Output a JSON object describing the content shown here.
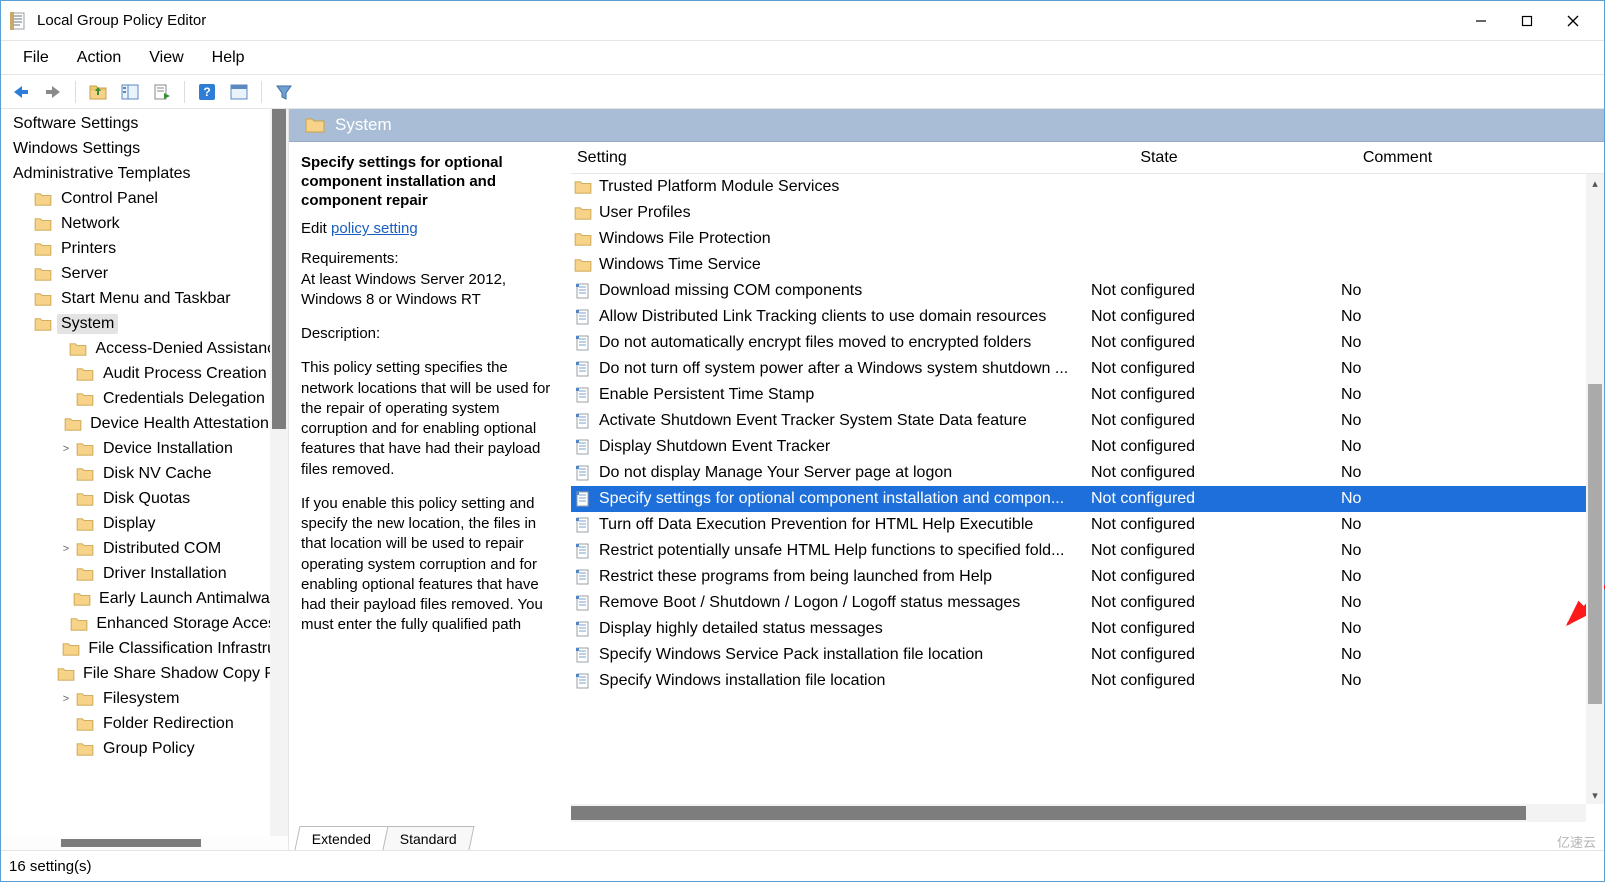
{
  "window": {
    "title": "Local Group Policy Editor"
  },
  "menubar": [
    "File",
    "Action",
    "View",
    "Help"
  ],
  "scope": {
    "label": "System"
  },
  "tree": [
    {
      "label": "Software Settings",
      "indent": 0,
      "icon": "none"
    },
    {
      "label": "Windows Settings",
      "indent": 0,
      "icon": "none"
    },
    {
      "label": "Administrative Templates",
      "indent": 0,
      "icon": "none"
    },
    {
      "label": "Control Panel",
      "indent": 1,
      "icon": "folder"
    },
    {
      "label": "Network",
      "indent": 1,
      "icon": "folder"
    },
    {
      "label": "Printers",
      "indent": 1,
      "icon": "folder"
    },
    {
      "label": "Server",
      "indent": 1,
      "icon": "folder"
    },
    {
      "label": "Start Menu and Taskbar",
      "indent": 1,
      "icon": "folder"
    },
    {
      "label": "System",
      "indent": 1,
      "icon": "folder",
      "selected": true
    },
    {
      "label": "Access-Denied Assistance",
      "indent": 2,
      "icon": "folder"
    },
    {
      "label": "Audit Process Creation",
      "indent": 2,
      "icon": "folder"
    },
    {
      "label": "Credentials Delegation",
      "indent": 2,
      "icon": "folder"
    },
    {
      "label": "Device Health Attestation S",
      "indent": 2,
      "icon": "folder"
    },
    {
      "label": "Device Installation",
      "indent": 2,
      "icon": "folder",
      "expander": ">"
    },
    {
      "label": "Disk NV Cache",
      "indent": 2,
      "icon": "folder"
    },
    {
      "label": "Disk Quotas",
      "indent": 2,
      "icon": "folder"
    },
    {
      "label": "Display",
      "indent": 2,
      "icon": "folder"
    },
    {
      "label": "Distributed COM",
      "indent": 2,
      "icon": "folder",
      "expander": ">"
    },
    {
      "label": "Driver Installation",
      "indent": 2,
      "icon": "folder"
    },
    {
      "label": "Early Launch Antimalware",
      "indent": 2,
      "icon": "folder"
    },
    {
      "label": "Enhanced Storage Access",
      "indent": 2,
      "icon": "folder"
    },
    {
      "label": "File Classification Infrastruc",
      "indent": 2,
      "icon": "folder"
    },
    {
      "label": "File Share Shadow Copy Pro",
      "indent": 2,
      "icon": "folder"
    },
    {
      "label": "Filesystem",
      "indent": 2,
      "icon": "folder",
      "expander": ">"
    },
    {
      "label": "Folder Redirection",
      "indent": 2,
      "icon": "folder"
    },
    {
      "label": "Group Policy",
      "indent": 2,
      "icon": "folder"
    }
  ],
  "description": {
    "title": "Specify settings for optional component installation and component repair",
    "edit_prefix": "Edit",
    "edit_link": "policy setting",
    "requirements_label": "Requirements:",
    "requirements_text": "At least Windows Server 2012, Windows 8 or Windows RT",
    "description_label": "Description:",
    "para1": "This policy setting specifies the network locations that will be used for the repair of operating system corruption and for enabling optional features that have had their payload files removed.",
    "para2": "If you enable this policy setting and specify the new location, the files in that location will be used to repair operating system corruption and for enabling optional features that have had their payload files removed. You must enter the fully qualified path"
  },
  "columns": {
    "setting": "Setting",
    "state": "State",
    "comment": "Comment"
  },
  "settings": [
    {
      "name": "Trusted Platform Module Services",
      "state": "",
      "comment": "",
      "type": "folder"
    },
    {
      "name": "User Profiles",
      "state": "",
      "comment": "",
      "type": "folder"
    },
    {
      "name": "Windows File Protection",
      "state": "",
      "comment": "",
      "type": "folder"
    },
    {
      "name": "Windows Time Service",
      "state": "",
      "comment": "",
      "type": "folder"
    },
    {
      "name": "Download missing COM components",
      "state": "Not configured",
      "comment": "No",
      "type": "policy"
    },
    {
      "name": "Allow Distributed Link Tracking clients to use domain resources",
      "state": "Not configured",
      "comment": "No",
      "type": "policy"
    },
    {
      "name": "Do not automatically encrypt files moved to encrypted folders",
      "state": "Not configured",
      "comment": "No",
      "type": "policy"
    },
    {
      "name": "Do not turn off system power after a Windows system shutdown ...",
      "state": "Not configured",
      "comment": "No",
      "type": "policy"
    },
    {
      "name": "Enable Persistent Time Stamp",
      "state": "Not configured",
      "comment": "No",
      "type": "policy"
    },
    {
      "name": "Activate Shutdown Event Tracker System State Data feature",
      "state": "Not configured",
      "comment": "No",
      "type": "policy"
    },
    {
      "name": "Display Shutdown Event Tracker",
      "state": "Not configured",
      "comment": "No",
      "type": "policy"
    },
    {
      "name": "Do not display Manage Your Server page at logon",
      "state": "Not configured",
      "comment": "No",
      "type": "policy"
    },
    {
      "name": "Specify settings for optional component installation and compon...",
      "state": "Not configured",
      "comment": "No",
      "type": "policy",
      "selected": true
    },
    {
      "name": "Turn off Data Execution Prevention for HTML Help Executible",
      "state": "Not configured",
      "comment": "No",
      "type": "policy"
    },
    {
      "name": "Restrict potentially unsafe HTML Help functions to specified fold...",
      "state": "Not configured",
      "comment": "No",
      "type": "policy"
    },
    {
      "name": "Restrict these programs from being launched from Help",
      "state": "Not configured",
      "comment": "No",
      "type": "policy"
    },
    {
      "name": "Remove Boot / Shutdown / Logon / Logoff status messages",
      "state": "Not configured",
      "comment": "No",
      "type": "policy"
    },
    {
      "name": "Display highly detailed status messages",
      "state": "Not configured",
      "comment": "No",
      "type": "policy"
    },
    {
      "name": "Specify Windows Service Pack installation file location",
      "state": "Not configured",
      "comment": "No",
      "type": "policy"
    },
    {
      "name": "Specify Windows installation file location",
      "state": "Not configured",
      "comment": "No",
      "type": "policy"
    }
  ],
  "tabs": {
    "extended": "Extended",
    "standard": "Standard"
  },
  "statusbar": {
    "text": "16 setting(s)"
  },
  "watermark": "亿速云"
}
